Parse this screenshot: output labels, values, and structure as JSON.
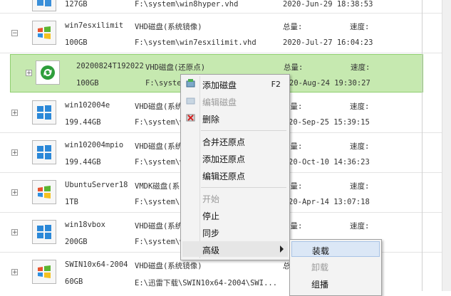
{
  "columns": {
    "total_label": "总量:",
    "speed_label": "速度:"
  },
  "rows": [
    {
      "name": "",
      "size": "127GB",
      "type": "",
      "path": "F:\\system\\win8hyper.vhd",
      "date": "2020-Jun-29 18:38:53",
      "expander": "",
      "icon": "windows-icon"
    },
    {
      "name": "win7esxilimit",
      "size": "100GB",
      "type": "VHD磁盘(系统镜像)",
      "path": "F:\\system\\win7esxilimit.vhd",
      "date": "2020-Jul-27 16:04:23",
      "expander": "−",
      "icon": "windows-icon"
    },
    {
      "name": "20200824T192022",
      "size": "100GB",
      "type": "VHD磁盘(还原点)",
      "path": "F:\\syste",
      "date": "20-Aug-24 19:30:27",
      "expander": "+",
      "icon": "restore-icon"
    },
    {
      "name": "win102004e",
      "size": "199.44GB",
      "type": "VHD磁盘(系统",
      "path": "F:\\system\\w",
      "date": "20-Sep-25 15:39:15",
      "expander": "+",
      "icon": "windows-icon"
    },
    {
      "name": "win102004mpio",
      "size": "199.44GB",
      "type": "VHD磁盘(系统",
      "path": "F:\\system\\w",
      "date": "20-Oct-10 14:36:23",
      "expander": "+",
      "icon": "windows-icon"
    },
    {
      "name": "UbuntuServer18",
      "size": "1TB",
      "type": "VMDK磁盘(系",
      "path": "F:\\system\\U",
      "date": "20-Apr-14 13:07:18",
      "expander": "+",
      "icon": "windows-icon"
    },
    {
      "name": "win18vbox",
      "size": "200GB",
      "type": "VHD磁盘(系统",
      "path": "F:\\system\\w",
      "date": "",
      "expander": "+",
      "icon": "windows-icon"
    },
    {
      "name": "SWIN10x64-2004",
      "size": "60GB",
      "type": "VHD磁盘(系统镜像)",
      "path": "E:\\迅雷下载\\SWIN10x64-2004\\SWI...",
      "date": "",
      "expander": "+",
      "icon": "windows-icon"
    }
  ],
  "context_menu": {
    "items": [
      {
        "label": "添加磁盘",
        "shortcut": "F2",
        "disabled": false,
        "icon": "add-disk-icon"
      },
      {
        "label": "编辑磁盘",
        "shortcut": "",
        "disabled": true,
        "icon": "edit-disk-icon"
      },
      {
        "label": "删除",
        "shortcut": "",
        "disabled": false,
        "icon": "delete-icon"
      },
      {
        "label": "合并还原点",
        "shortcut": "",
        "disabled": false,
        "icon": ""
      },
      {
        "label": "添加还原点",
        "shortcut": "",
        "disabled": false,
        "icon": ""
      },
      {
        "label": "编辑还原点",
        "shortcut": "",
        "disabled": false,
        "icon": ""
      },
      {
        "label": "开始",
        "shortcut": "",
        "disabled": true,
        "icon": ""
      },
      {
        "label": "停止",
        "shortcut": "",
        "disabled": false,
        "icon": ""
      },
      {
        "label": "同步",
        "shortcut": "",
        "disabled": false,
        "icon": ""
      },
      {
        "label": "高级",
        "shortcut": "",
        "disabled": false,
        "icon": "submenu-arrow-icon"
      }
    ]
  },
  "submenu": {
    "items": [
      {
        "label": "装载",
        "disabled": false
      },
      {
        "label": "卸载",
        "disabled": true
      },
      {
        "label": "组播",
        "disabled": false
      }
    ]
  },
  "colors": {
    "selected_row": "#c6e9b0",
    "selected_border": "#8fcf6f",
    "menu_bg": "#f3f3f3",
    "highlight": "#dbe7f6"
  }
}
